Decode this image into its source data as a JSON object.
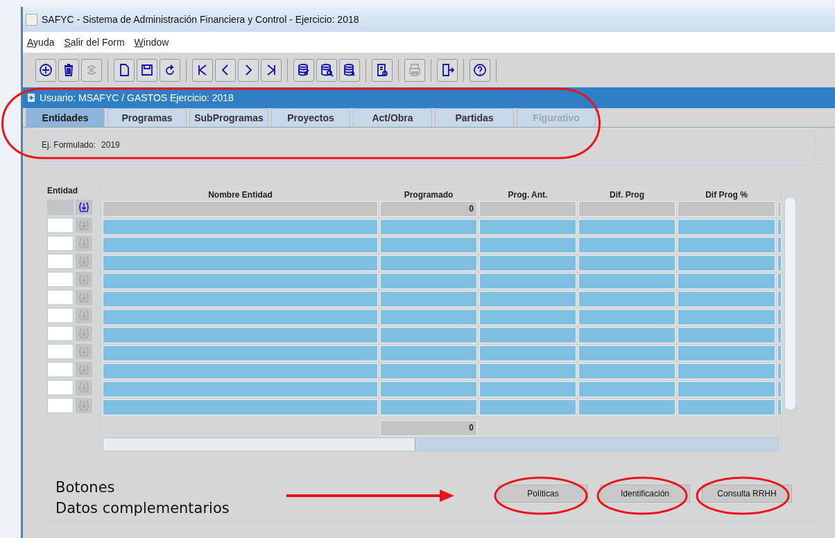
{
  "window": {
    "title": "SAFYC - Sistema de Administración Financiera y Control - Ejercicio: 2018"
  },
  "menu": [
    "Ayuda",
    "Salir del Form",
    "Window"
  ],
  "toolbar": [
    [
      {
        "kind": "add",
        "disabled": false
      },
      {
        "kind": "delete",
        "disabled": false
      },
      {
        "kind": "clear",
        "disabled": true
      }
    ],
    [
      {
        "kind": "new",
        "disabled": false
      },
      {
        "kind": "save",
        "disabled": false
      },
      {
        "kind": "refresh",
        "disabled": false
      }
    ],
    [
      {
        "kind": "first",
        "disabled": false
      },
      {
        "kind": "prev",
        "disabled": false
      },
      {
        "kind": "next",
        "disabled": false
      },
      {
        "kind": "last",
        "disabled": false
      }
    ],
    [
      {
        "kind": "db-edit",
        "disabled": false
      },
      {
        "kind": "db-search",
        "disabled": false
      },
      {
        "kind": "db-delete",
        "disabled": false
      }
    ],
    [
      {
        "kind": "report",
        "disabled": false
      }
    ],
    [
      {
        "kind": "print",
        "disabled": true
      }
    ],
    [
      {
        "kind": "exit",
        "disabled": false
      }
    ],
    [
      {
        "kind": "help",
        "disabled": false
      }
    ]
  ],
  "form_header": "Usuario: MSAFYC  /  GASTOS  Ejercicio: 2018",
  "tabs": [
    {
      "label": "Entidades",
      "selected": true,
      "disabled": false
    },
    {
      "label": "Programas",
      "selected": false,
      "disabled": false
    },
    {
      "label": "SubProgramas",
      "selected": false,
      "disabled": false
    },
    {
      "label": "Proyectos",
      "selected": false,
      "disabled": false
    },
    {
      "label": "Act/Obra",
      "selected": false,
      "disabled": false
    },
    {
      "label": "Partidas",
      "selected": false,
      "disabled": false
    },
    {
      "label": "Figurativo",
      "selected": false,
      "disabled": true
    }
  ],
  "ej_formulado": {
    "label": "Ej. Formulado:",
    "value": "2019"
  },
  "entity_label": "Entidad",
  "table": {
    "columns": [
      "Nombre Entidad",
      "Programado",
      "Prog. Ant.",
      "Dif. Prog",
      "Dif Prog %"
    ],
    "rows": [
      {
        "current": true,
        "programado": "0"
      },
      {
        "current": false
      },
      {
        "current": false
      },
      {
        "current": false
      },
      {
        "current": false
      },
      {
        "current": false
      },
      {
        "current": false
      },
      {
        "current": false
      },
      {
        "current": false
      },
      {
        "current": false
      },
      {
        "current": false
      },
      {
        "current": false
      }
    ],
    "total_programado": "0"
  },
  "buttons": [
    "Políticas",
    "Identificación",
    "Consulta RRHH"
  ],
  "annotation": {
    "lines": [
      "Botones",
      "Datos complementarios"
    ]
  }
}
